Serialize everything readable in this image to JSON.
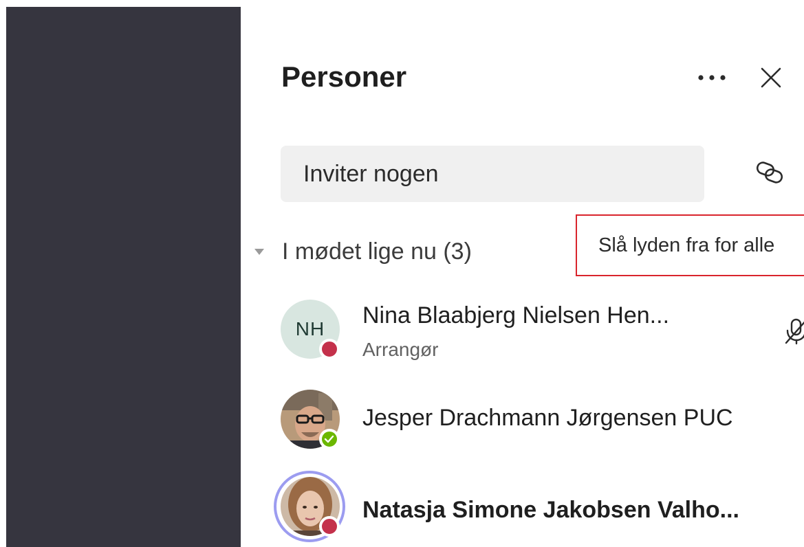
{
  "panel": {
    "title": "Personer",
    "more_icon": "more-horizontal-icon",
    "close_icon": "close-icon"
  },
  "invite": {
    "placeholder": "Inviter nogen",
    "link_icon": "link-icon"
  },
  "section": {
    "label": "I mødet lige nu (3)",
    "mute_all_label": "Slå lyden fra for alle",
    "highlight_color": "#d9242c"
  },
  "participants": [
    {
      "initials": "NH",
      "name": "Nina Blaabjerg Nielsen Hen...",
      "role": "Arrangør",
      "status": "busy",
      "status_color": "#c4314b",
      "muted": true
    },
    {
      "initials": "",
      "name": "Jesper Drachmann Jørgensen PUC",
      "role": "",
      "status": "available",
      "status_color": "#6bb700",
      "muted": false
    },
    {
      "initials": "",
      "name": "Natasja Simone Jakobsen Valho...",
      "role": "",
      "status": "busy",
      "status_color": "#c4314b",
      "speaking": true,
      "speaking_color": "#9c9cf0"
    }
  ],
  "colors": {
    "sidebar": "#36353f",
    "invite_bg": "#f0f0f0",
    "text": "#1f1f1f"
  }
}
